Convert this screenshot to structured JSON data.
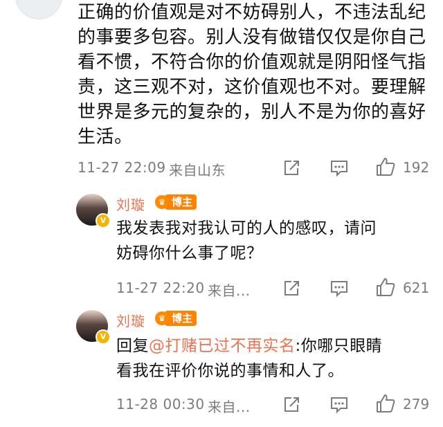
{
  "comment": {
    "text": "正确的价值观是对不妨碍别人，不违法乱纪\n的事要多包容。别人没有做错仅仅是你自己\n看不惯，不符合你的价值观就是阴阳怪气指\n责，这三观不对，这价值观也不对。要理解\n世界是多元的复杂的，别人不是为你的喜好\n生活。",
    "time": "11-27 22:09",
    "location": "来自山东",
    "likes": "192"
  },
  "replies": [
    {
      "name": "刘璇",
      "badge": "博主",
      "text": "我发表我对我认可的人的感叹，请问\n妨碍你什么事了呢？",
      "time": "11-27 22:20",
      "location": "来自...",
      "likes": "621"
    },
    {
      "name": "刘璇",
      "badge": "博主",
      "reply_prefix": "回复",
      "mention": "@打赌已过不再实名",
      "text_after_mention": ":你哪只眼睛\n看我在评价你说的事情和人了。",
      "time": "11-28 00:30",
      "location": "来自...",
      "likes": "279"
    }
  ],
  "icons": {
    "share": "share-icon",
    "comment": "comment-icon",
    "like": "thumbs-up-icon",
    "verified": "verified-v-icon",
    "crown": "crown-icon"
  },
  "colors": {
    "name": "#eb7350",
    "badge": "#ff8200",
    "meta": "#7b7b7b",
    "mention": "#eb7350"
  }
}
